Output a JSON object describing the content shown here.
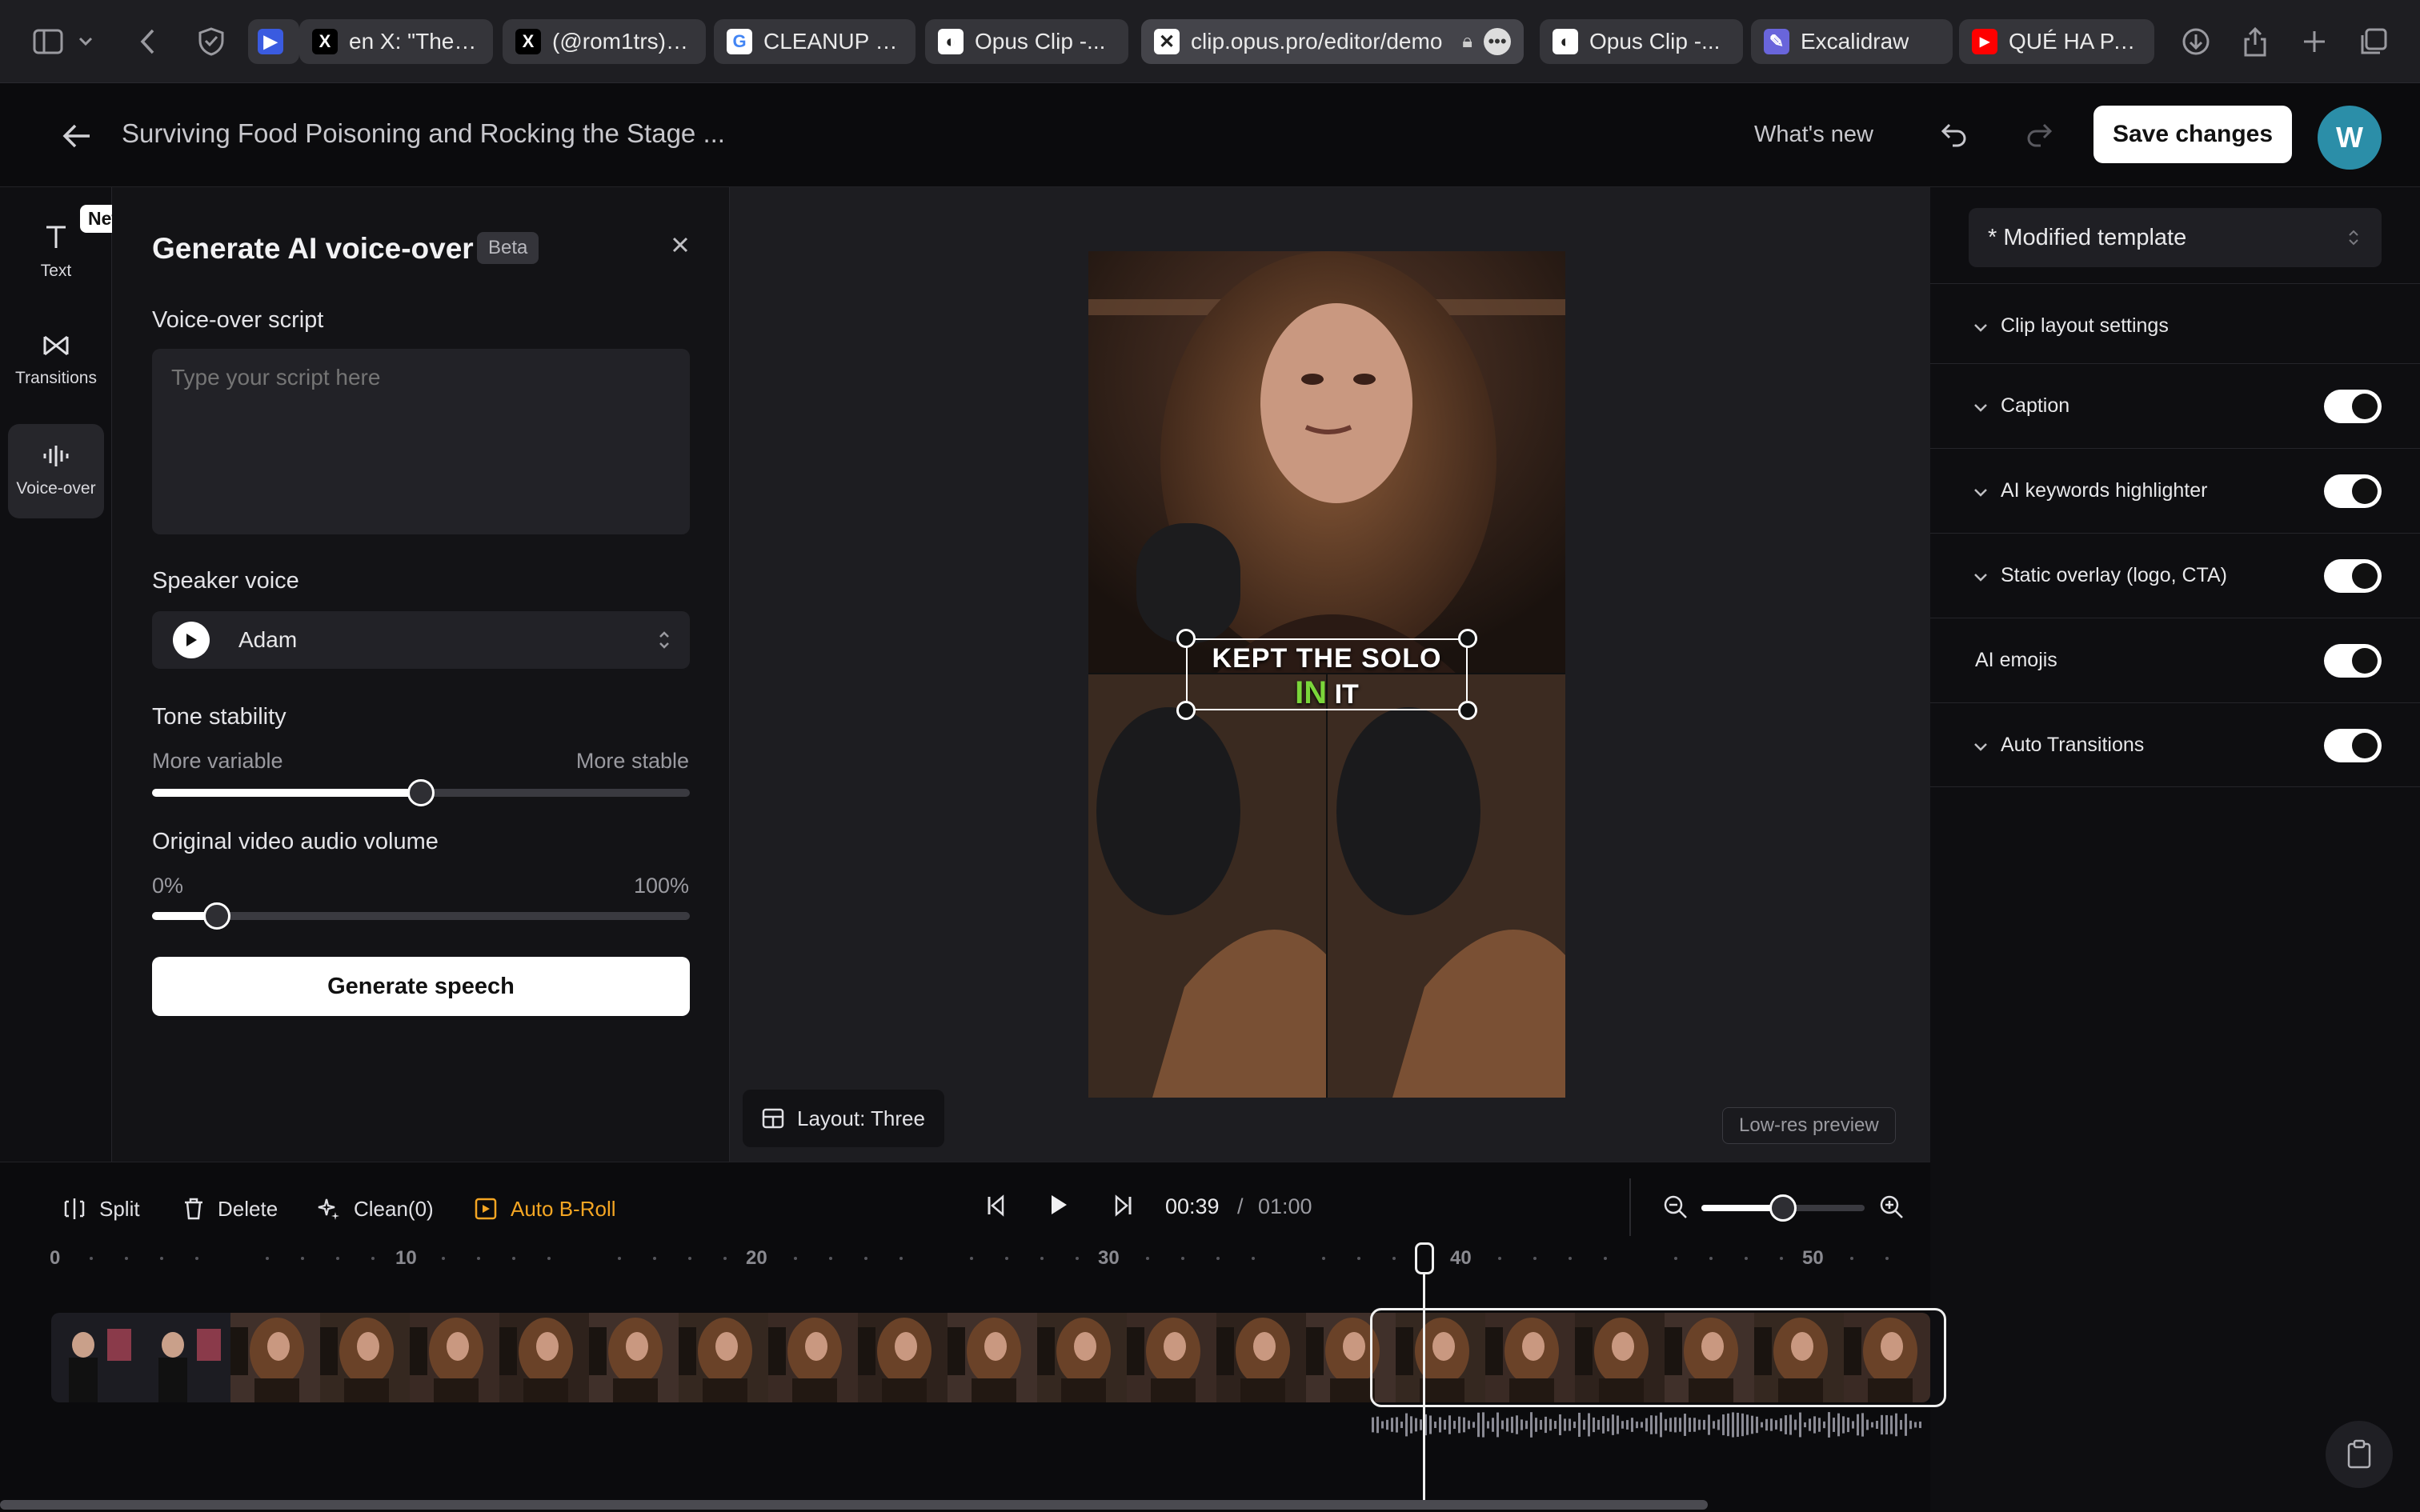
{
  "browser": {
    "tabs": [
      {
        "label": "",
        "favicon": "video-meeting-icon",
        "color": "#3a5be0"
      },
      {
        "label": "en X: \"There'...",
        "favicon": "x-logo-icon",
        "color": "#000000"
      },
      {
        "label": "(@rom1trs) / X",
        "favicon": "x-logo-icon",
        "color": "#000000"
      },
      {
        "label": "CLEANUP ap...",
        "favicon": "google-icon",
        "color": "#ffffff"
      },
      {
        "label": "Opus Clip -...",
        "favicon": "opus-clip-icon",
        "color": "#222222"
      },
      {
        "label": "clip.opus.pro/editor/demo",
        "favicon": "close-square-icon",
        "color": "#ffffff"
      },
      {
        "label": "Opus Clip -...",
        "favicon": "opus-clip-icon",
        "color": "#222222"
      },
      {
        "label": "Excalidraw",
        "favicon": "excalidraw-icon",
        "color": "#6965db"
      },
      {
        "label": "QUÉ HA PAS...",
        "favicon": "youtube-icon",
        "color": "#ff0000"
      }
    ]
  },
  "header": {
    "title": "Surviving Food Poisoning and Rocking the Stage ...",
    "whats_new": "What's new",
    "save_label": "Save changes",
    "avatar_initial": "W"
  },
  "rail": {
    "new_badge": "New",
    "items": [
      {
        "label": "Text",
        "icon": "text-icon"
      },
      {
        "label": "Transitions",
        "icon": "transitions-icon"
      },
      {
        "label": "Voice-over",
        "icon": "waveform-icon"
      }
    ]
  },
  "voiceover": {
    "title": "Generate AI voice-over",
    "badge": "Beta",
    "script_label": "Voice-over script",
    "script_placeholder": "Type your script here",
    "speaker_label": "Speaker voice",
    "speaker_value": "Adam",
    "tone_label": "Tone stability",
    "tone_left": "More variable",
    "tone_right": "More stable",
    "tone_value": 0.5,
    "volume_label": "Original video audio volume",
    "volume_left": "0%",
    "volume_right": "100%",
    "volume_value": 0.12,
    "generate_label": "Generate speech"
  },
  "preview": {
    "caption_line1": "KEPT THE SOLO",
    "caption_word_highlight": "IN",
    "caption_word_rest": "IT",
    "highlight_color": "#7ad63a",
    "layout_label": "Layout: Three",
    "lowres_label": "Low-res preview"
  },
  "rightpanel": {
    "template": "* Modified template",
    "rows": [
      {
        "label": "Clip layout settings",
        "chevron": true,
        "toggle": null
      },
      {
        "label": "Caption",
        "chevron": true,
        "toggle": true
      },
      {
        "label": "AI keywords highlighter",
        "chevron": true,
        "toggle": true
      },
      {
        "label": "Static overlay (logo, CTA)",
        "chevron": true,
        "toggle": true
      },
      {
        "label": "AI emojis",
        "chevron": false,
        "toggle": true
      },
      {
        "label": "Auto Transitions",
        "chevron": true,
        "toggle": true
      }
    ]
  },
  "timeline": {
    "split": "Split",
    "delete": "Delete",
    "clean": "Clean(0)",
    "auto_broll": "Auto B-Roll",
    "auto_broll_color": "#f5a623",
    "current_time": "00:39",
    "separator": "/",
    "total_time": "01:00",
    "zoom_value": 0.5,
    "ruler": [
      "0",
      "10",
      "20",
      "30",
      "40",
      "50"
    ]
  }
}
